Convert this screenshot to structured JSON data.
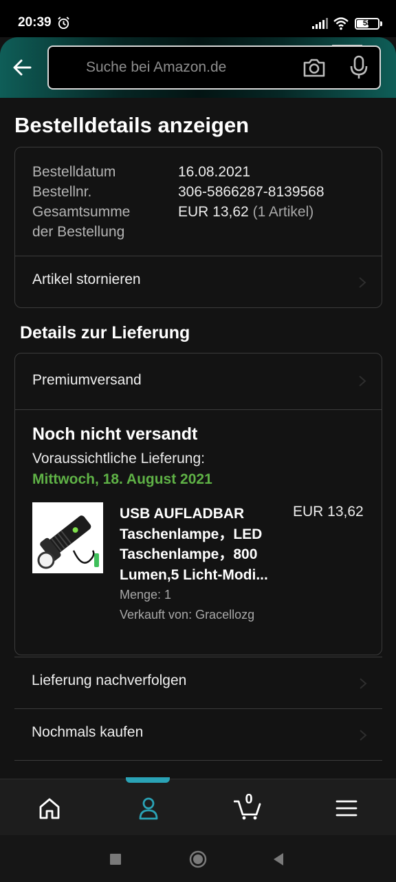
{
  "status_bar": {
    "time": "20:39",
    "battery": "58",
    "battery_level": 0.58
  },
  "header": {
    "search_placeholder": "Suche bei Amazon.de"
  },
  "page": {
    "title": "Bestelldetails anzeigen"
  },
  "order_summary": {
    "date_label": "Bestelldatum",
    "date_value": "16.08.2021",
    "number_label": "Bestellnr.",
    "number_value": "306-5866287-8139568",
    "total_label_line1": "Gesamtsumme",
    "total_label_line2": "der Bestellung",
    "total_value": "EUR 13,62",
    "total_items": "(1 Artikel)",
    "cancel_label": "Artikel stornieren"
  },
  "delivery": {
    "section_title": "Details zur Lieferung",
    "shipping_method": "Premiumversand",
    "status": "Noch nicht versandt",
    "eta_label": "Voraussichtliche Lieferung:",
    "eta_date": "Mittwoch, 18. August 2021",
    "eta_color": "#5fb246",
    "product": {
      "title": "USB AUFLADBAR Taschenlampe，LED Taschenlampe，800 Lumen,5 Licht-Modi...",
      "price": "EUR 13,62",
      "quantity": "Menge: 1",
      "seller": "Verkauft von: Gracellozg"
    }
  },
  "actions": {
    "track_label": "Lieferung nachverfolgen",
    "buy_again_label": "Nochmals kaufen"
  },
  "bottom_nav": {
    "items": [
      "home-icon",
      "account-icon",
      "cart-icon",
      "menu-icon"
    ],
    "cart_count": "0",
    "active": "account",
    "accent": "#2aa3b6"
  }
}
